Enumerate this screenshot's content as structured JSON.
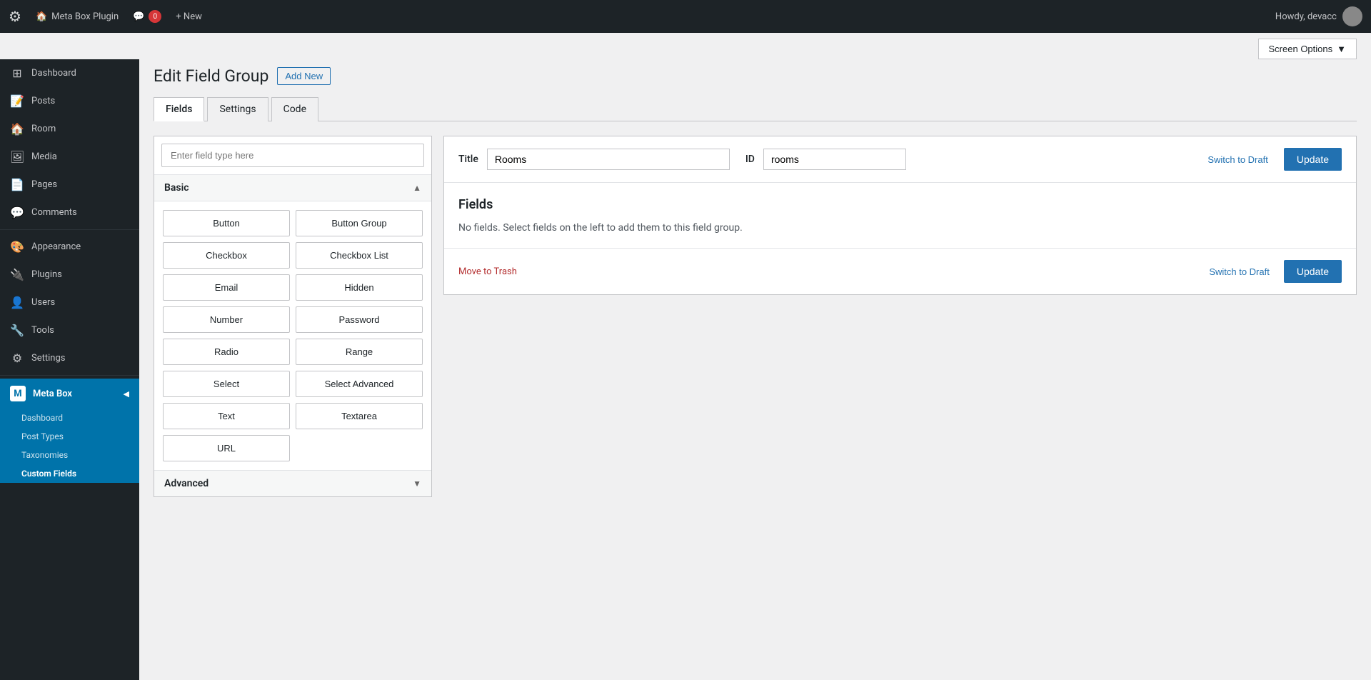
{
  "adminbar": {
    "logo": "⚙",
    "site_name": "Meta Box Plugin",
    "comment_icon": "💬",
    "comment_count": "0",
    "new_label": "+ New",
    "howdy": "Howdy, devacc"
  },
  "screen_options": {
    "label": "Screen Options",
    "arrow": "▼"
  },
  "sidebar": {
    "items": [
      {
        "id": "dashboard",
        "icon": "⊞",
        "label": "Dashboard"
      },
      {
        "id": "posts",
        "icon": "📝",
        "label": "Posts"
      },
      {
        "id": "room",
        "icon": "🏠",
        "label": "Room"
      },
      {
        "id": "media",
        "icon": "🖼",
        "label": "Media"
      },
      {
        "id": "pages",
        "icon": "📄",
        "label": "Pages"
      },
      {
        "id": "comments",
        "icon": "💬",
        "label": "Comments"
      },
      {
        "id": "appearance",
        "icon": "🎨",
        "label": "Appearance"
      },
      {
        "id": "plugins",
        "icon": "🔌",
        "label": "Plugins"
      },
      {
        "id": "users",
        "icon": "👤",
        "label": "Users"
      },
      {
        "id": "tools",
        "icon": "🔧",
        "label": "Tools"
      },
      {
        "id": "settings",
        "icon": "⚙",
        "label": "Settings"
      }
    ],
    "metabox": {
      "icon": "M",
      "label": "Meta Box",
      "arrow": "◀"
    },
    "submenu": [
      {
        "id": "mb-dashboard",
        "label": "Dashboard",
        "active": false
      },
      {
        "id": "post-types",
        "label": "Post Types",
        "active": false
      },
      {
        "id": "taxonomies",
        "label": "Taxonomies",
        "active": false
      },
      {
        "id": "custom-fields",
        "label": "Custom Fields",
        "active": true
      }
    ]
  },
  "page": {
    "title": "Edit Field Group",
    "add_new_label": "Add New"
  },
  "tabs": [
    {
      "id": "fields",
      "label": "Fields",
      "active": true
    },
    {
      "id": "settings",
      "label": "Settings",
      "active": false
    },
    {
      "id": "code",
      "label": "Code",
      "active": false
    }
  ],
  "field_search": {
    "placeholder": "Enter field type here"
  },
  "field_groups": {
    "basic": {
      "label": "Basic",
      "toggle": "▲",
      "fields": [
        {
          "id": "button",
          "label": "Button"
        },
        {
          "id": "button-group",
          "label": "Button Group"
        },
        {
          "id": "checkbox",
          "label": "Checkbox"
        },
        {
          "id": "checkbox-list",
          "label": "Checkbox List"
        },
        {
          "id": "email",
          "label": "Email"
        },
        {
          "id": "hidden",
          "label": "Hidden"
        },
        {
          "id": "number",
          "label": "Number"
        },
        {
          "id": "password",
          "label": "Password"
        },
        {
          "id": "radio",
          "label": "Radio"
        },
        {
          "id": "range",
          "label": "Range"
        },
        {
          "id": "select",
          "label": "Select"
        },
        {
          "id": "select-advanced",
          "label": "Select Advanced"
        },
        {
          "id": "text",
          "label": "Text"
        },
        {
          "id": "textarea",
          "label": "Textarea"
        }
      ],
      "url": {
        "id": "url",
        "label": "URL"
      }
    },
    "advanced": {
      "label": "Advanced",
      "toggle": "▼"
    }
  },
  "edit_panel": {
    "title_label": "Title",
    "title_value": "Rooms",
    "id_label": "ID",
    "id_value": "rooms",
    "switch_to_draft": "Switch to Draft",
    "update": "Update",
    "fields_heading": "Fields",
    "no_fields_text": "No fields. Select fields on the left to add them to this field group.",
    "move_to_trash": "Move to Trash"
  }
}
